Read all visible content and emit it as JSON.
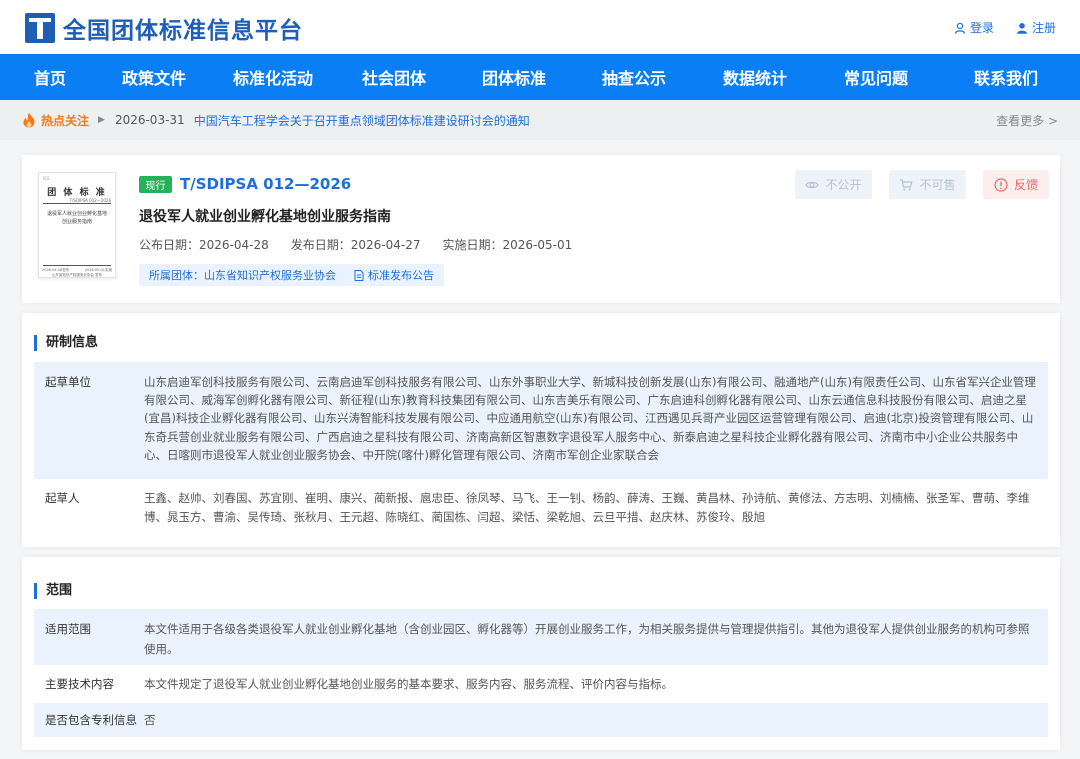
{
  "site": {
    "title": "全国团体标准信息平台",
    "brand_color": "#1e5fb5"
  },
  "auth": {
    "login": "登录",
    "register": "注册"
  },
  "nav": [
    "首页",
    "政策文件",
    "标准化活动",
    "社会团体",
    "团体标准",
    "抽查公示",
    "数据统计",
    "常见问题",
    "联系我们"
  ],
  "hot": {
    "label": "热点关注",
    "date": "2026-03-31",
    "link": "中国汽车工程学会关于召开重点领域团体标准建设研讨会的通知",
    "more": "查看更多 >"
  },
  "cover": {
    "small": "ICS",
    "title": "团 体 标 准",
    "code": "T/SDIPSA 012—2026",
    "name": "退役军人就业创业孵化基地创业服务指南",
    "foot_left": "2026-04-28发布",
    "foot_right": "2026-05-01实施",
    "org": "山东省知识产权服务业协会 发布"
  },
  "standard": {
    "status": "现行",
    "code": "T/SDIPSA 012—2026",
    "name": "退役军人就业创业孵化基地创业服务指南",
    "announce_date": "公布日期：2026-04-28",
    "release_date": "发布日期：2026-04-27",
    "impl_date": "实施日期：2026-05-01",
    "org_tag": "所属团体：山东省知识产权服务业协会",
    "notice_tag": "标准发布公告"
  },
  "actions": {
    "public": "不公开",
    "sell": "不可售",
    "feedback": "反馈"
  },
  "research": {
    "title": "研制信息",
    "drafting_units_label": "起草单位",
    "drafting_units": "山东启迪军创科技服务有限公司、云南启迪军创科技服务有限公司、山东外事职业大学、新城科技创新发展(山东)有限公司、融通地产(山东)有限责任公司、山东省军兴企业管理有限公司、威海军创孵化器有限公司、新征程(山东)教育科技集团有限公司、山东吉美乐有限公司、广东启迪科创孵化器有限公司、山东云通信息科技股份有限公司、启迪之星(宜昌)科技企业孵化器有限公司、山东兴涛智能科技发展有限公司、中应通用航空(山东)有限公司、江西遇见兵哥产业园区运营管理有限公司、启迪(北京)投资管理有限公司、山东奇兵营创业就业服务有限公司、广西启迪之星科技有限公司、济南高新区智惠数字退役军人服务中心、新泰启迪之星科技企业孵化器有限公司、济南市中小企业公共服务中心、日喀则市退役军人就业创业服务协会、中开院(喀什)孵化管理有限公司、济南市军创企业家联合会",
    "drafters_label": "起草人",
    "drafters": "王鑫、赵帅、刘春国、苏宜刚、崔明、康兴、蔺新报、扈忠臣、徐凤琴、马飞、王一钊、杨韵、薛涛、王巍、黄昌林、孙诗航、黄修法、方志明、刘楠楠、张圣军、曹萌、李维博、晁玉方、曹渝、吴传琦、张秋月、王元超、陈晓红、蔺国栋、闫超、梁恬、梁乾旭、云旦平措、赵庆林、苏俊玲、殷旭"
  },
  "scope": {
    "title": "范围",
    "applicable_label": "适用范围",
    "applicable": "本文件适用于各级各类退役军人就业创业孵化基地（含创业园区、孵化器等）开展创业服务工作，为相关服务提供与管理提供指引。其他为退役军人提供创业服务的机构可参照使用。",
    "tech_label": "主要技术内容",
    "tech": "本文件规定了退役军人就业创业孵化基地创业服务的基本要求、服务内容、服务流程、评价内容与指标。",
    "patent_label": "是否包含专利信息",
    "patent": "否"
  }
}
